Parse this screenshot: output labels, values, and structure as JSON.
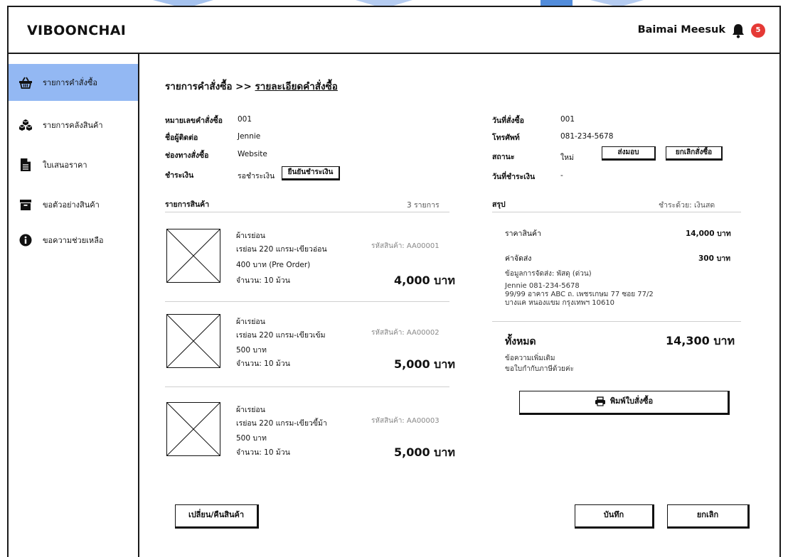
{
  "app": {
    "brand": "VIBOONCHAI",
    "user_name": "Baimai Meesuk",
    "notification_count": "5"
  },
  "sidebar": {
    "items": [
      {
        "label": "รายการคำสั่งซื้อ",
        "icon": "basket-icon",
        "active": true
      },
      {
        "label": "รายการคลังสินค้า",
        "icon": "boxes-icon",
        "active": false
      },
      {
        "label": "ใบเสนอราคา",
        "icon": "document-icon",
        "active": false
      },
      {
        "label": "ขอตัวอย่างสินค้า",
        "icon": "archive-box-icon",
        "active": false
      },
      {
        "label": "ขอความช่วยเหลือ",
        "icon": "info-icon",
        "active": false
      }
    ]
  },
  "breadcrumb": {
    "parent": "รายการคำสั่งซื้อ",
    "separator": ">>",
    "current": "รายละเอียดคำสั่งซื้อ"
  },
  "order": {
    "number_label": "หมายเลขคำสั่งซื้อ",
    "number": "001",
    "contact_label": "ชื่อผู้ติดต่อ",
    "contact": "Jennie",
    "channel_label": "ช่องทางสั่งซื้อ",
    "channel": "Website",
    "payment_label": "ชำระเงิน",
    "payment_status": "รอชำระเงิน",
    "confirm_payment_button": "ยืนยันชำระเงิน",
    "date_label": "วันที่สั่งซื้อ",
    "date": "001",
    "phone_label": "โทรศัพท์",
    "phone": "081-234-5678",
    "status_label": "สถานะ",
    "status": "ใหม่",
    "deliver_button": "ส่งมอบ",
    "cancel_order_button": "ยกเลิกสั่งซื้อ",
    "paid_date_label": "วันที่ชำระเงิน",
    "paid_date": "-"
  },
  "products": {
    "title": "รายการสินค้า",
    "count": "3 รายการ",
    "items": [
      {
        "name": "ผ้าเรย่อน",
        "spec": "เรย่อน 220 แกรม-เขียวอ่อน",
        "price": "400 บาท  (Pre Order)",
        "qty": "จำนวน: 10 ม้วน",
        "code": "รหัสสินค้า: AA00001",
        "total": "4,000 บาท"
      },
      {
        "name": "ผ้าเรย่อน",
        "spec": "เรย่อน 220 แกรม-เขียวเข้ม",
        "price": "500 บาท",
        "qty": "จำนวน: 10 ม้วน",
        "code": "รหัสสินค้า: AA00002",
        "total": "5,000 บาท"
      },
      {
        "name": "ผ้าเรย่อน",
        "spec": "เรย่อน 220 แกรม-เขียวขี้ม้า",
        "price": "500 บาท",
        "qty": "จำนวน: 10 ม้วน",
        "code": "รหัสสินค้า: AA00003",
        "total": "5,000 บาท"
      }
    ]
  },
  "summary": {
    "title": "สรุป",
    "payment_method": "ชำระด้วย: เงินสด",
    "subtotal_label": "ราคาสินค้า",
    "subtotal": "14,000 บาท",
    "shipping_label": "ค่าจัดส่ง",
    "shipping": "300 บาท",
    "shipping_info_title": "ข้อมูลการจัดส่ง: พัสดุ (ด่วน)",
    "shipping_contact": "Jennie 081-234-5678",
    "shipping_address_1": "99/99 อาคาร ABC ถ. เพชรเกษม 77 ซอย 77/2",
    "shipping_address_2": "บางแค หนองแขม กรุงเทพฯ 10610",
    "total_label": "ทั้งหมด",
    "total": "14,300 บาท",
    "note_label": "ข้อความเพิ่มเติม",
    "note": "ขอใบกำกับภาษีด้วยค่ะ",
    "print_button": "พิมพ์ใบสั่งซื้อ"
  },
  "footer": {
    "exchange_button": "เปลี่ยน/คืนสินค้า",
    "save_button": "บันทึก",
    "cancel_button": "ยกเลิก"
  },
  "colors": {
    "active_sidebar": "#93b8f3",
    "badge": "#e53935",
    "top_decoration": "#3f7fd6"
  }
}
